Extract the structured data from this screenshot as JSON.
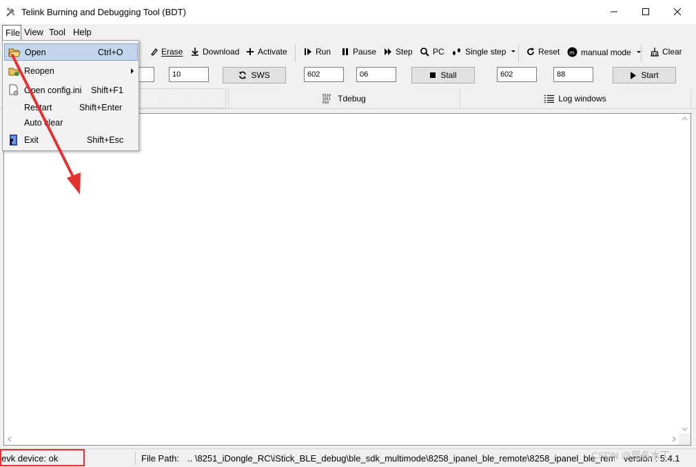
{
  "window": {
    "title": "Telink Burning and Debugging Tool (BDT)",
    "minimize": "—",
    "maximize": "☐",
    "close": "✕"
  },
  "menubar": {
    "items": [
      "File",
      "View",
      "Tool",
      "Help"
    ]
  },
  "toolbar": {
    "erase": "Erase",
    "download": "Download",
    "activate": "Activate",
    "run": "Run",
    "pause": "Pause",
    "step": "Step",
    "pc": "PC",
    "single_step": "Single step",
    "reset": "Reset",
    "manual_mode": "manual mode",
    "clear": "Clear"
  },
  "params": {
    "input1": "",
    "input2": "10",
    "sws": "SWS",
    "input3": "602",
    "input4": "06",
    "stall": "Stall",
    "input5": "602",
    "input6": "88",
    "start": "Start"
  },
  "tabs": {
    "tdebug": "Tdebug",
    "log": "Log windows"
  },
  "file_menu": {
    "items": [
      {
        "label": "Open",
        "shortcut": "Ctrl+O"
      },
      {
        "label": "Reopen",
        "shortcut": "▸"
      },
      {
        "label": "Open config.ini",
        "shortcut": "Shift+F1"
      },
      {
        "label": "Restart",
        "shortcut": "Shift+Enter"
      },
      {
        "label": "Auto clear",
        "shortcut": ""
      },
      {
        "label": "Exit",
        "shortcut": "Shift+Esc"
      }
    ]
  },
  "statusbar": {
    "device": "evk device: ok",
    "path_label": "File Path:",
    "path": "..  \\8251_iDongle_RC\\iStick_BLE_debug\\ble_sdk_multimode\\8258_ipanel_ble_remote\\8258_ipanel_ble_remote.",
    "version": "version : 5.4.1"
  },
  "watermark": "CSDN @昆名水丁",
  "colors": {
    "menu_highlight": "#c5d5ec",
    "annotation_red": "#e53030"
  }
}
